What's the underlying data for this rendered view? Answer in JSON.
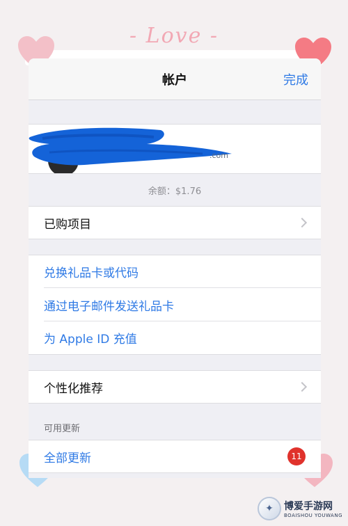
{
  "decor": {
    "title": "- Love -",
    "watermark_main": "博爱手游网",
    "watermark_sub": "BOAISHOU YOUWANG"
  },
  "navbar": {
    "title": "帐户",
    "done_label": "完成"
  },
  "account": {
    "email_tail": ".com",
    "balance": "余额：$1.76"
  },
  "rows": {
    "purchased": "已购项目",
    "redeem": "兑换礼品卡或代码",
    "send_gift": "通过电子邮件发送礼品卡",
    "add_funds": "为 Apple ID 充值",
    "personalized": "个性化推荐"
  },
  "updates": {
    "header": "可用更新",
    "update_all": "全部更新",
    "badge_count": "11"
  },
  "colors": {
    "link_blue": "#2f7ae5",
    "badge_red": "#e0322c",
    "scribble_blue": "#1463d8",
    "heart_pink": "#f3a9b3",
    "heart_red": "#f47b84",
    "heart_blue": "#b6dbf5"
  }
}
